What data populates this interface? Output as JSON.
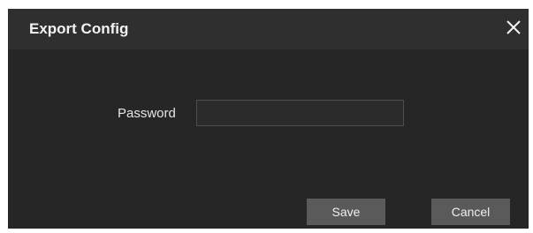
{
  "dialog": {
    "title": "Export Config",
    "close_icon": "close-icon"
  },
  "form": {
    "password_label": "Password",
    "password_value": "",
    "password_placeholder": ""
  },
  "buttons": {
    "save_label": "Save",
    "cancel_label": "Cancel"
  },
  "colors": {
    "dialog_bg": "#262626",
    "titlebar_bg": "#2f2f2f",
    "button_bg": "#5a5a5a",
    "text": "#f2f2f2"
  }
}
